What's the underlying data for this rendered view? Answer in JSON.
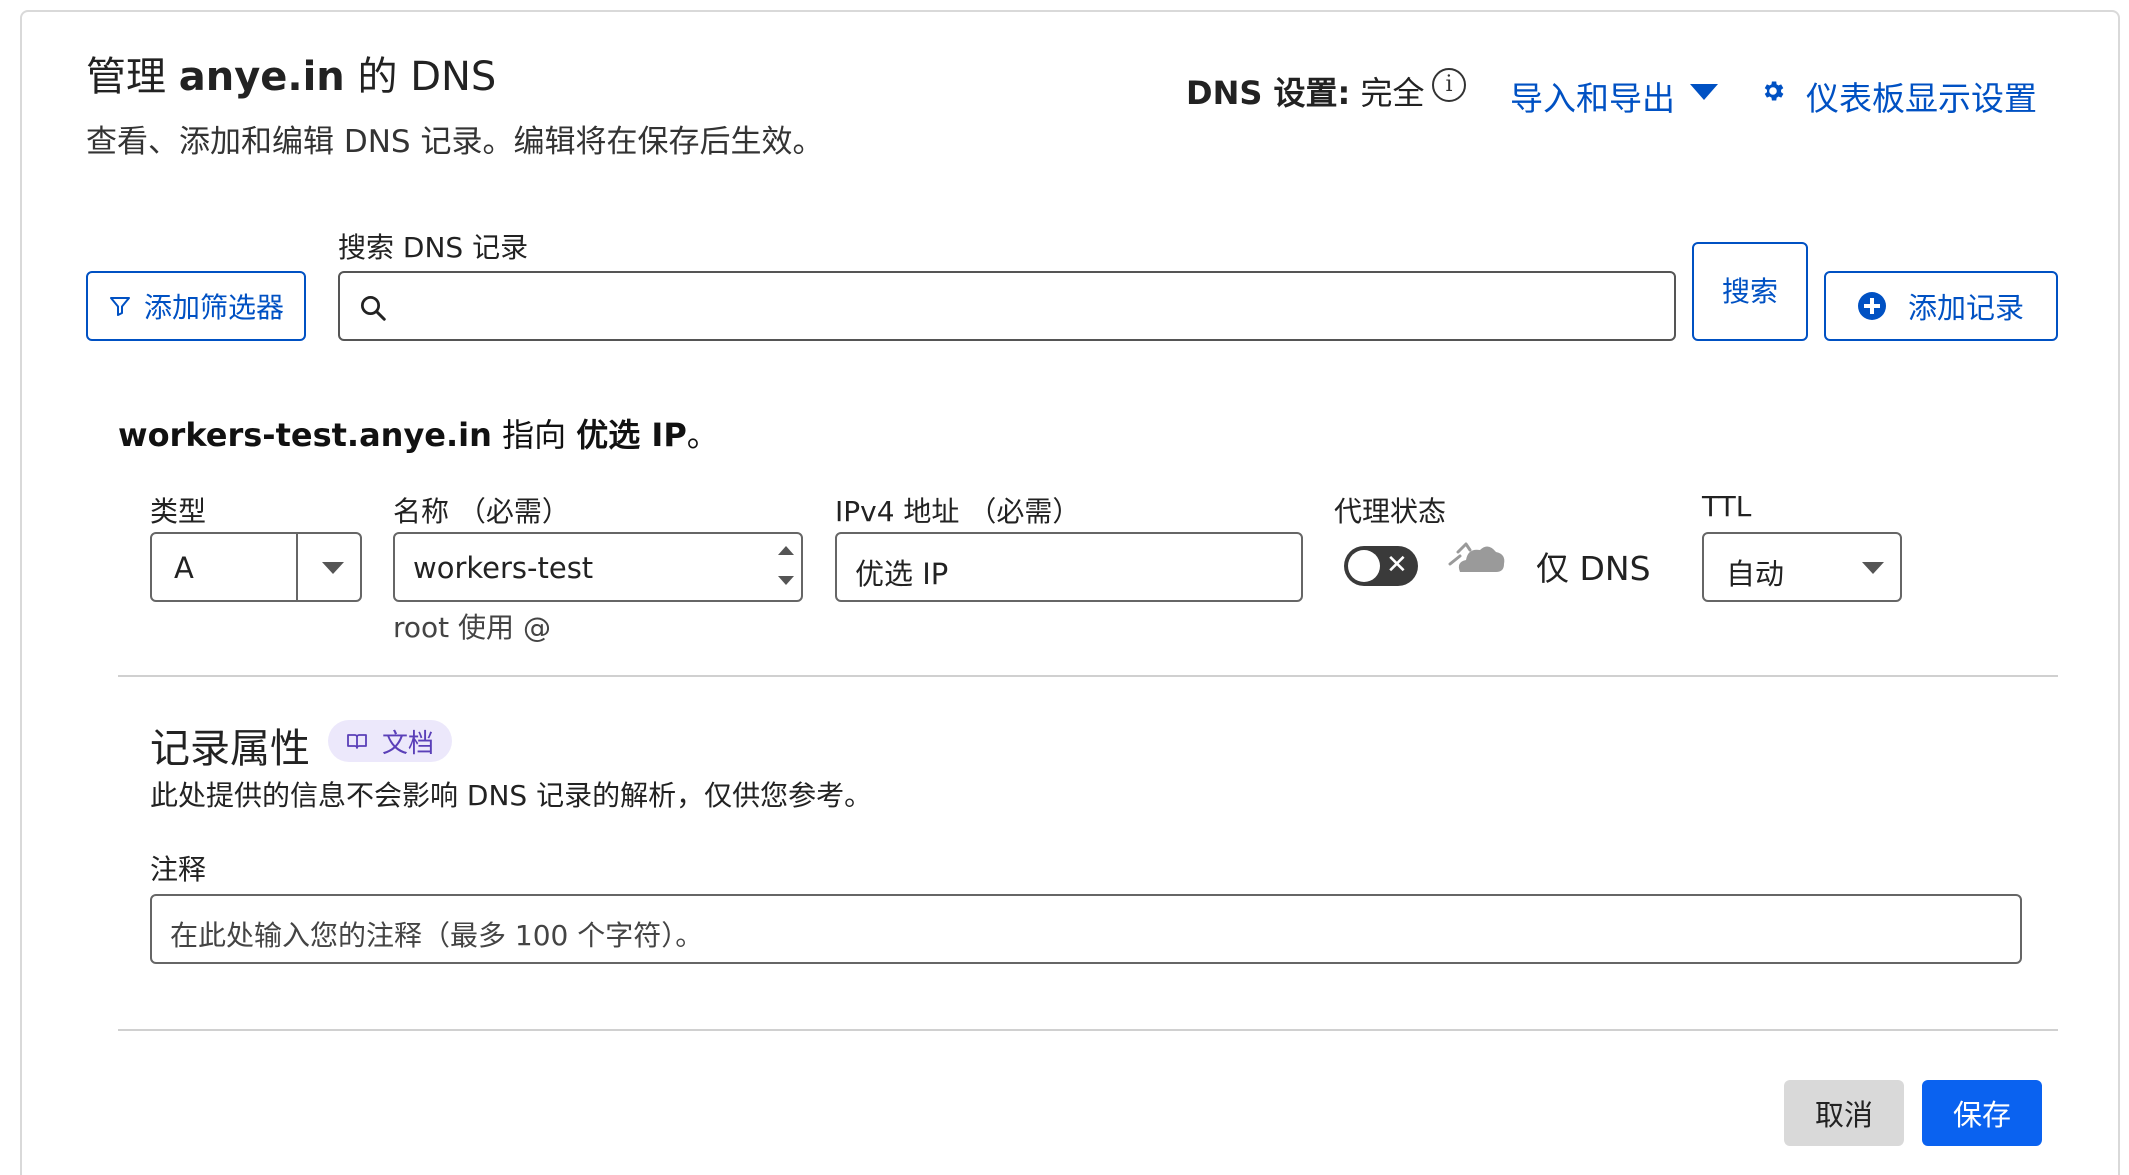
{
  "header": {
    "title_prefix": "管理",
    "domain": "anye.in",
    "title_suffix": "的 DNS",
    "subtitle": "查看、添加和编辑 DNS 记录。编辑将在保存后生效。",
    "dns_setting_label": "DNS 设置:",
    "dns_setting_value": "完全",
    "info_glyph": "i",
    "import_export_label": "导入和导出",
    "dashboard_settings_label": "仪表板显示设置"
  },
  "toolbar": {
    "filter_label": "添加筛选器",
    "search_label": "搜索 DNS 记录",
    "search_value": "",
    "search_button_label": "搜索",
    "add_record_label": "添加记录"
  },
  "summary": {
    "name": "workers-test.anye.in",
    "middle": "指向",
    "target": "优选 IP",
    "end": "。"
  },
  "form": {
    "type_label": "类型",
    "type_value": "A",
    "name_label": "名称 （必需）",
    "name_value": "workers-test",
    "name_hint": "root 使用 @",
    "ipv4_label": "IPv4 地址 （必需）",
    "ipv4_value": "优选 IP",
    "proxy_label": "代理状态",
    "proxy_enabled": false,
    "proxy_toggle_glyph": "✕",
    "proxy_text": "仅 DNS",
    "ttl_label": "TTL",
    "ttl_value": "自动"
  },
  "attributes": {
    "title": "记录属性",
    "docs_badge": "文档",
    "description": "此处提供的信息不会影响 DNS 记录的解析，仅供您参考。",
    "comment_label": "注释",
    "comment_placeholder": "在此处输入您的注释（最多 100 个字符）。"
  },
  "actions": {
    "cancel_label": "取消",
    "save_label": "保存"
  },
  "colors": {
    "accent": "#0051c3",
    "primary_button": "#0a62f0",
    "cancel_button": "#d9d9d9",
    "badge_bg": "#ece8fb",
    "badge_text": "#5a3fb8"
  },
  "icons": {
    "filter": "filter-icon",
    "search": "search-icon",
    "add": "plus-circle-icon",
    "settings": "gear-icon",
    "info": "info-icon",
    "dropdown": "chevron-down-icon",
    "proxy": "cloud-icon",
    "docs": "book-icon"
  }
}
